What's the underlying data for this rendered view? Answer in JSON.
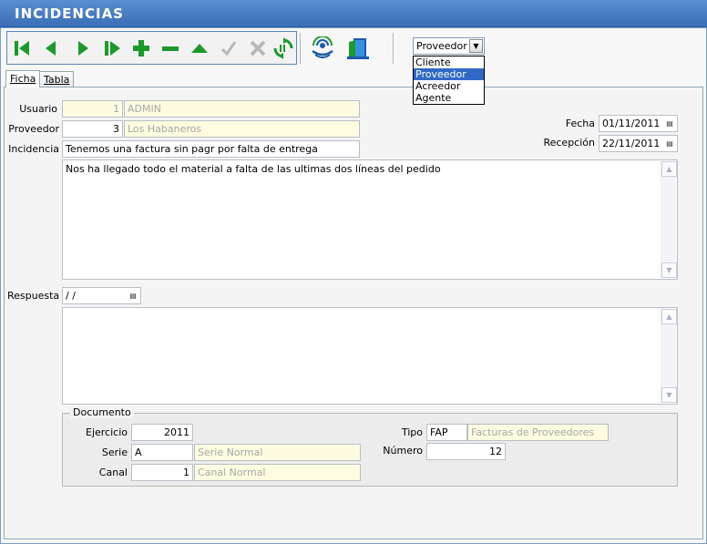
{
  "window": {
    "title": "INCIDENCIAS"
  },
  "toolbar": {
    "buttons": [
      {
        "name": "first-record-icon"
      },
      {
        "name": "previous-record-icon"
      },
      {
        "name": "next-record-icon"
      },
      {
        "name": "last-record-icon"
      },
      {
        "name": "add-record-icon"
      },
      {
        "name": "delete-record-icon"
      },
      {
        "name": "edit-record-icon"
      },
      {
        "name": "confirm-icon"
      },
      {
        "name": "cancel-icon"
      },
      {
        "name": "refresh-icon"
      }
    ],
    "extra": [
      {
        "name": "broadcast-icon"
      },
      {
        "name": "exit-door-icon"
      }
    ],
    "colors": {
      "accent": "#1a9a2a",
      "disabled": "#b8b8b8",
      "blue": "#1a5aaa"
    }
  },
  "entity_select": {
    "value": "Proveedor",
    "options": [
      "Cliente",
      "Proveedor",
      "Acreedor",
      "Agente"
    ],
    "highlighted": "Proveedor"
  },
  "tabs": [
    {
      "label": "Ficha",
      "active": true
    },
    {
      "label": "Tabla",
      "active": false
    }
  ],
  "form": {
    "usuario": {
      "label": "Usuario",
      "code": "1",
      "name": "ADMIN"
    },
    "proveedor": {
      "label": "Proveedor",
      "code": "3",
      "name": "Los Habaneros"
    },
    "incidencia": {
      "label": "Incidencia",
      "value": "Tenemos una factura sin pagr por falta de entrega"
    },
    "fecha": {
      "label": "Fecha",
      "value": "01/11/2011"
    },
    "recepcion": {
      "label": "Recepción",
      "value": "22/11/2011"
    },
    "description": "Nos ha llegado todo el material a falta de las ultimas dos líneas del pedido",
    "respuesta": {
      "label": "Respuesta",
      "date": " /  /",
      "text": ""
    }
  },
  "documento": {
    "title": "Documento",
    "ejercicio": {
      "label": "Ejercicio",
      "value": "2011"
    },
    "serie": {
      "label": "Serie",
      "code": "A",
      "name": "Serie Normal"
    },
    "canal": {
      "label": "Canal",
      "code": "1",
      "name": "Canal Normal"
    },
    "tipo": {
      "label": "Tipo",
      "code": "FAP",
      "name": "Facturas de Proveedores"
    },
    "numero": {
      "label": "Número",
      "value": "12"
    }
  }
}
